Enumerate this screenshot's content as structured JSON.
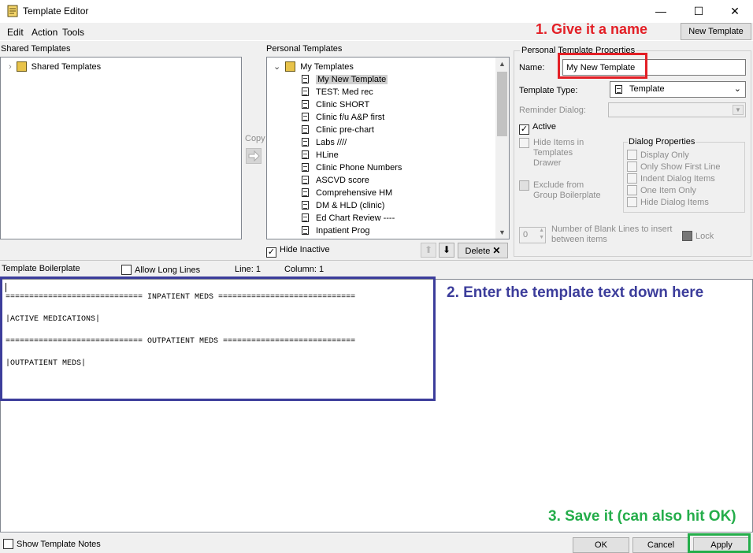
{
  "window": {
    "title": "Template Editor",
    "minimize_glyph": "—",
    "maximize_glyph": "☐",
    "close_glyph": "✕"
  },
  "menu": {
    "edit": "Edit",
    "action": "Action",
    "tools": "Tools"
  },
  "toolbar": {
    "new_template_label": "New Template"
  },
  "annotations": {
    "step1": "1. Give it a name",
    "step2": "2. Enter the template text down here",
    "step3": "3. Save it (can also hit OK)",
    "step1_color": "#e31f26",
    "step2_color": "#3c3d9b",
    "step3_color": "#24ad4a"
  },
  "shared": {
    "header": "Shared Templates",
    "root_label": "Shared Templates"
  },
  "copy_label": "Copy",
  "personal": {
    "header": "Personal Templates",
    "root_label": "My Templates",
    "items": [
      "My New Template",
      "TEST: Med rec",
      "Clinic SHORT",
      "Clinic f/u A&P first",
      "Clinic pre-chart",
      "Labs ////",
      "HLine",
      "Clinic Phone Numbers",
      "ASCVD score",
      "Comprehensive HM",
      "DM & HLD (clinic)",
      "Ed Chart Review ----",
      "Inpatient Prog"
    ],
    "selected_index": 0,
    "hide_inactive_label": "Hide Inactive",
    "delete_label": "Delete"
  },
  "properties": {
    "group_title": "Personal Template Properties",
    "name_label": "Name:",
    "name_value": "My New Template",
    "template_type_label": "Template Type:",
    "template_type_value": "Template",
    "reminder_dialog_label": "Reminder Dialog:",
    "active_label": "Active",
    "hide_items_label_1": "Hide Items in",
    "hide_items_label_2": "Templates",
    "hide_items_label_3": "Drawer",
    "exclude_label_1": "Exclude from",
    "exclude_label_2": "Group Boilerplate",
    "dialog_props_title": "Dialog Properties",
    "dialog_options": [
      "Display Only",
      "Only Show First Line",
      "Indent Dialog Items",
      "One Item Only",
      "Hide Dialog Items"
    ],
    "blank_lines_value": "0",
    "blank_lines_label_1": "Number of Blank Lines to insert",
    "blank_lines_label_2": "between items",
    "lock_label": "Lock"
  },
  "boilerplate": {
    "header": "Template Boilerplate",
    "allow_long_lines_label": "Allow Long Lines",
    "line_label": "Line: 1",
    "column_label": "Column: 1",
    "lines": [
      "============================= INPATIENT MEDS =============================",
      "",
      "|ACTIVE MEDICATIONS|",
      "",
      "============================= OUTPATIENT MEDS ============================",
      "",
      "|OUTPATIENT MEDS|"
    ]
  },
  "footer": {
    "show_notes_label": "Show Template Notes",
    "ok_label": "OK",
    "cancel_label": "Cancel",
    "apply_label": "Apply"
  }
}
